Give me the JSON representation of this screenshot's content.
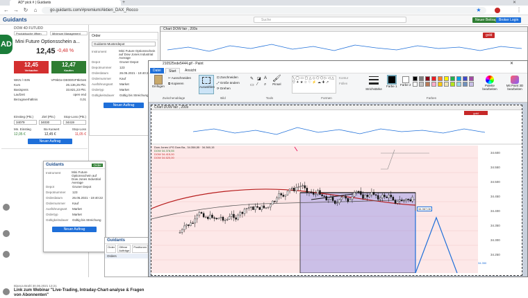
{
  "browser": {
    "tab_title": "AD* pick # | Guidants",
    "url": "go.guidants.com/#premium/Aktien_DAX_Rocco",
    "new_post_label": "Neuer Beitrag",
    "login_label": "Broker Login"
  },
  "site": {
    "logo_text": "Guidants",
    "search_placeholder": "Suche",
    "top_chart_title": "Chart DOW fair , 200s",
    "gold_label": "gold"
  },
  "leftpanel": {
    "header_small": "DOW 4D FUTUDD",
    "tabs": [
      "Produktsuche öffnen",
      "Minimum Management"
    ],
    "product_title": "Mini Future Optionsschein a...",
    "price_main": "12,45",
    "price_change": "-0,48 %",
    "bid_value": "12,45",
    "ask_value": "12,47",
    "bid_label": "Verkaufen",
    "ask_label": "Kaufen",
    "details": [
      {
        "label": "WKN / ISIN",
        "value": "VF9kGe DE000VF9kGe6"
      },
      {
        "label": "Kurs",
        "value": "26.136,25 Pkt."
      },
      {
        "label": "Basispreis",
        "value": "33.821,23 Pkt."
      },
      {
        "label": "Laufzeit",
        "value": "open end"
      },
      {
        "label": "Bezugsverhältnis",
        "value": "0,01"
      }
    ],
    "order_labels": [
      "Einstieg (Pkt.)",
      "Ziel (Pkt.)",
      "Stop-Loss (Pkt.)"
    ],
    "order_values": [
      "34079",
      "34030",
      "34419"
    ],
    "order_labels2": [
      "Mn. Einstieg",
      "Ba Kurwert",
      "Stop-Loss"
    ],
    "order_values2": [
      "12,05 €",
      "12,45 €",
      "11,05 €"
    ],
    "order_button": "Neuer Auftrag",
    "author": "Bianca Brahl 30.06.2021 13:21",
    "webinar_text": "Link zum Webinar \"Live-Trading, Intraday-Chart-analyse & Fragen von Abonnenten\""
  },
  "orderform": {
    "title": "Order",
    "broker_label": "Guidants-Musterdepot",
    "rows": [
      {
        "label": "Instrument",
        "value": "Mini Future Optionsschein auf Dow Jones Industrial Average"
      },
      {
        "label": "Depot",
        "value": "Gruner Depot"
      },
      {
        "label": "Depotnummer",
        "value": "123"
      },
      {
        "label": "Orderdatum",
        "value": "26.05.2021 - 19:40:22"
      },
      {
        "label": "Ordernummer",
        "value": "Kauf"
      },
      {
        "label": "Ausführungsart",
        "value": "Market"
      },
      {
        "label": "Ordertyp",
        "value": "Market"
      },
      {
        "label": "Gültigkeitsdauer",
        "value": "Gültig bis Streichung"
      }
    ],
    "submit": "Neuer Auftrag"
  },
  "popup": {
    "logo": "Guidants",
    "order_label": "Order",
    "button": "Neuer Auftrag",
    "depot_items": [
      "Order",
      "Offene Aufträge",
      "Positionen"
    ],
    "orders_tab": "Orders"
  },
  "paint": {
    "title": "210525nde5444.gif - Paint",
    "tabs": [
      "Datei",
      "Start",
      "Ansicht"
    ],
    "groups": [
      "Zwischenablage",
      "Bild",
      "Tools",
      "Formen",
      "Farben"
    ],
    "buttons": {
      "paste": "Einfügen",
      "cut": "Ausschneiden",
      "copy": "Kopieren",
      "select": "Auswählen",
      "crop": "Zuschneiden",
      "resize": "Größe ändern",
      "rotate": "Drehen",
      "brushes": "Pinsel",
      "outline": "Kontur",
      "fill": "Füllen",
      "size": "Strichstärke",
      "color1": "Farbe 1",
      "color2": "Farbe 2",
      "edit_colors": "Palette bearbeiten",
      "paint3d": "Mit Paint 3D bearbeiten"
    },
    "palette": [
      "#000000",
      "#7f7f7f",
      "#880015",
      "#ed1c24",
      "#ff7f27",
      "#fff200",
      "#22b14c",
      "#00a2e8",
      "#3f48cc",
      "#a349a4",
      "#ffffff",
      "#c3c3c3",
      "#b97a57",
      "#ffaec9",
      "#ffc90e",
      "#efe4b0",
      "#b5e61d",
      "#99d9ea",
      "#7092be",
      "#c8bfe7"
    ]
  },
  "chart_inner": {
    "title": "Chart DOW fair , 200s",
    "legend": [
      "Dow Jones LPG Dow Ba., 34.358,55 · 34.360,15",
      "DOW 34.378,55",
      "DOW 34.415,00",
      "DOW 34.520,00"
    ],
    "price_labels": [
      "34.600",
      "34.550",
      "34.500",
      "34.450",
      "34.400",
      "34.350",
      "34.300",
      "34.250"
    ],
    "annotations": [
      "34.367,08",
      "34.350"
    ]
  }
}
